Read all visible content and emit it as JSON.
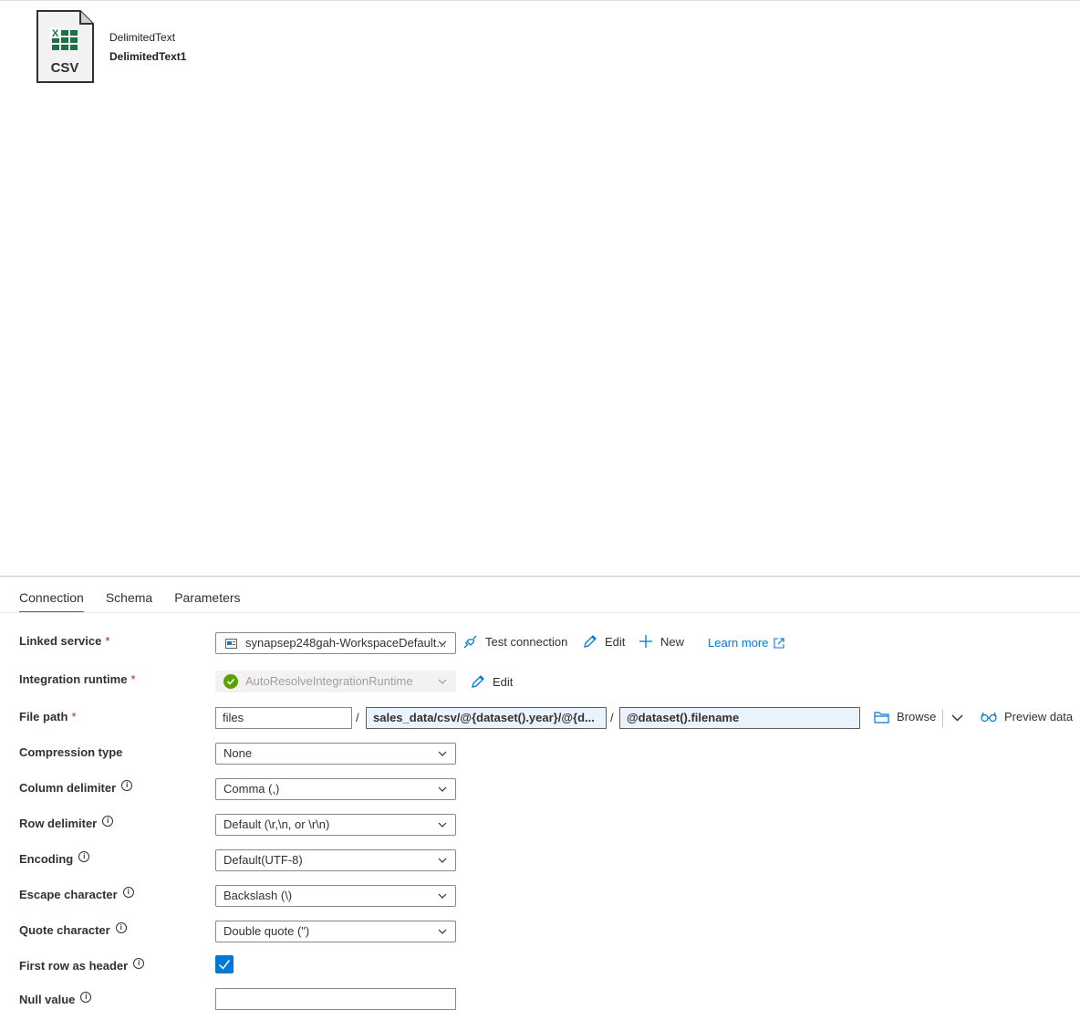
{
  "dataset": {
    "type_label": "DelimitedText",
    "name": "DelimitedText1",
    "icon_text": "CSV"
  },
  "tabs": [
    {
      "label": "Connection",
      "active": true
    },
    {
      "label": "Schema",
      "active": false
    },
    {
      "label": "Parameters",
      "active": false
    }
  ],
  "linked_service": {
    "label": "Linked service",
    "value": "synapsep248gah-WorkspaceDefault...",
    "test_connection": "Test connection",
    "edit": "Edit",
    "new": "New",
    "learn_more": "Learn more"
  },
  "integration_runtime": {
    "label": "Integration runtime",
    "value": "AutoResolveIntegrationRuntime",
    "edit": "Edit"
  },
  "file_path": {
    "label": "File path",
    "container": "files",
    "directory": "sales_data/csv/@{dataset().year}/@{d...",
    "file": "@dataset().filename",
    "separator": "/",
    "browse": "Browse",
    "preview": "Preview data"
  },
  "compression_type": {
    "label": "Compression type",
    "value": "None"
  },
  "column_delimiter": {
    "label": "Column delimiter",
    "value": "Comma (,)"
  },
  "row_delimiter": {
    "label": "Row delimiter",
    "value": "Default (\\r,\\n, or \\r\\n)"
  },
  "encoding": {
    "label": "Encoding",
    "value": "Default(UTF-8)"
  },
  "escape_character": {
    "label": "Escape character",
    "value": "Backslash (\\)"
  },
  "quote_character": {
    "label": "Quote character",
    "value": "Double quote (\")"
  },
  "first_row_header": {
    "label": "First row as header",
    "checked": true
  },
  "null_value": {
    "label": "Null value",
    "value": ""
  },
  "required_mark": "*",
  "info_mark": "i",
  "colors": {
    "accent": "#0078d4",
    "success": "#57a300",
    "excel_green": "#1e7145"
  }
}
